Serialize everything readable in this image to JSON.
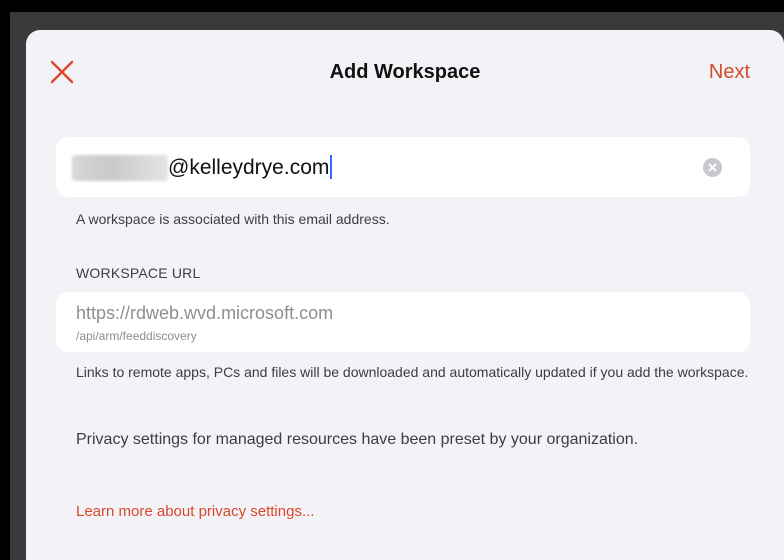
{
  "nav": {
    "title": "Add Workspace",
    "next_label": "Next",
    "close_icon": "close-x-icon"
  },
  "email": {
    "value_visible": "@kelleydrye.com",
    "caption": "A workspace is associated with this email address.",
    "clear_icon": "clear-circle-icon"
  },
  "workspace_url": {
    "header": "WORKSPACE URL",
    "line1": "https://rdweb.wvd.microsoft.com",
    "line2": "/api/arm/feeddiscovery",
    "caption": "Links to remote apps, PCs and files will be downloaded and automatically updated if you add the workspace."
  },
  "privacy": {
    "text": "Privacy settings for managed resources have been preset by your organization.",
    "link_label": "Learn more about privacy settings..."
  },
  "colors": {
    "accent": "#d9482b",
    "sheet_background": "#f2f2f7",
    "field_background": "#ffffff",
    "caret": "#3366ff"
  }
}
